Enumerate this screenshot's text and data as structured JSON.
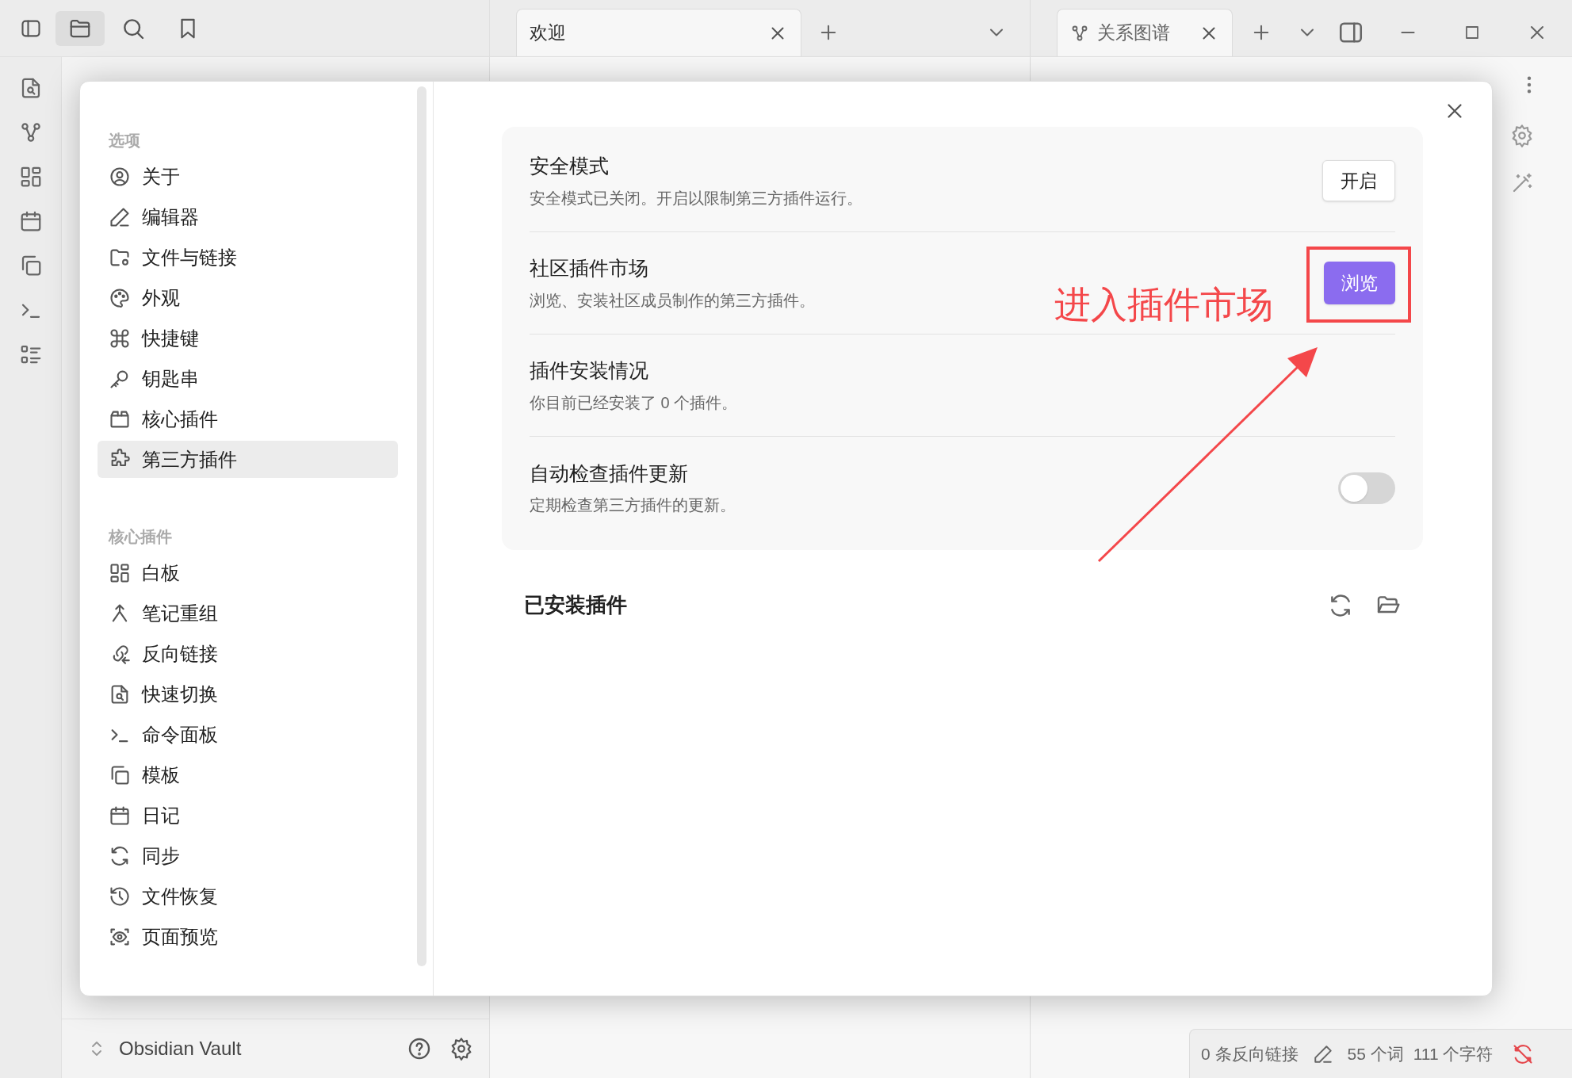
{
  "editor_tabs": [
    {
      "label": "欢迎",
      "selected": true
    }
  ],
  "graph_tabs": [
    {
      "label": "关系图谱",
      "selected": true
    }
  ],
  "settings": {
    "groups": [
      {
        "heading": "选项",
        "items": [
          {
            "label": "关于",
            "selected": false
          },
          {
            "label": "编辑器",
            "selected": false
          },
          {
            "label": "文件与链接",
            "selected": false
          },
          {
            "label": "外观",
            "selected": false
          },
          {
            "label": "快捷键",
            "selected": false
          },
          {
            "label": "钥匙串",
            "selected": false
          },
          {
            "label": "核心插件",
            "selected": false
          },
          {
            "label": "第三方插件",
            "selected": true
          }
        ]
      },
      {
        "heading": "核心插件",
        "items": [
          {
            "label": "白板",
            "selected": false
          },
          {
            "label": "笔记重组",
            "selected": false
          },
          {
            "label": "反向链接",
            "selected": false
          },
          {
            "label": "快速切换",
            "selected": false
          },
          {
            "label": "命令面板",
            "selected": false
          },
          {
            "label": "模板",
            "selected": false
          },
          {
            "label": "日记",
            "selected": false
          },
          {
            "label": "同步",
            "selected": false
          },
          {
            "label": "文件恢复",
            "selected": false
          },
          {
            "label": "页面预览",
            "selected": false
          }
        ]
      }
    ],
    "rows": [
      {
        "title": "安全模式",
        "description": "安全模式已关闭。开启以限制第三方插件运行。",
        "control": {
          "kind": "button",
          "label": "开启"
        }
      },
      {
        "title": "社区插件市场",
        "description": "浏览、安装社区成员制作的第三方插件。",
        "control": {
          "kind": "cta",
          "label": "浏览"
        }
      },
      {
        "title": "插件安装情况",
        "description": "你目前已经安装了 0 个插件。"
      },
      {
        "title": "自动检查插件更新",
        "description": "定期检查第三方插件的更新。",
        "control": {
          "kind": "toggle",
          "on": false
        }
      }
    ],
    "installed_heading": "已安装插件"
  },
  "annotation": {
    "text": "进入插件市场"
  },
  "vault": {
    "name": "Obsidian Vault"
  },
  "status_bar": {
    "backlinks": "0 条反向链接",
    "words": "55 个词",
    "characters": "111 个字符"
  }
}
